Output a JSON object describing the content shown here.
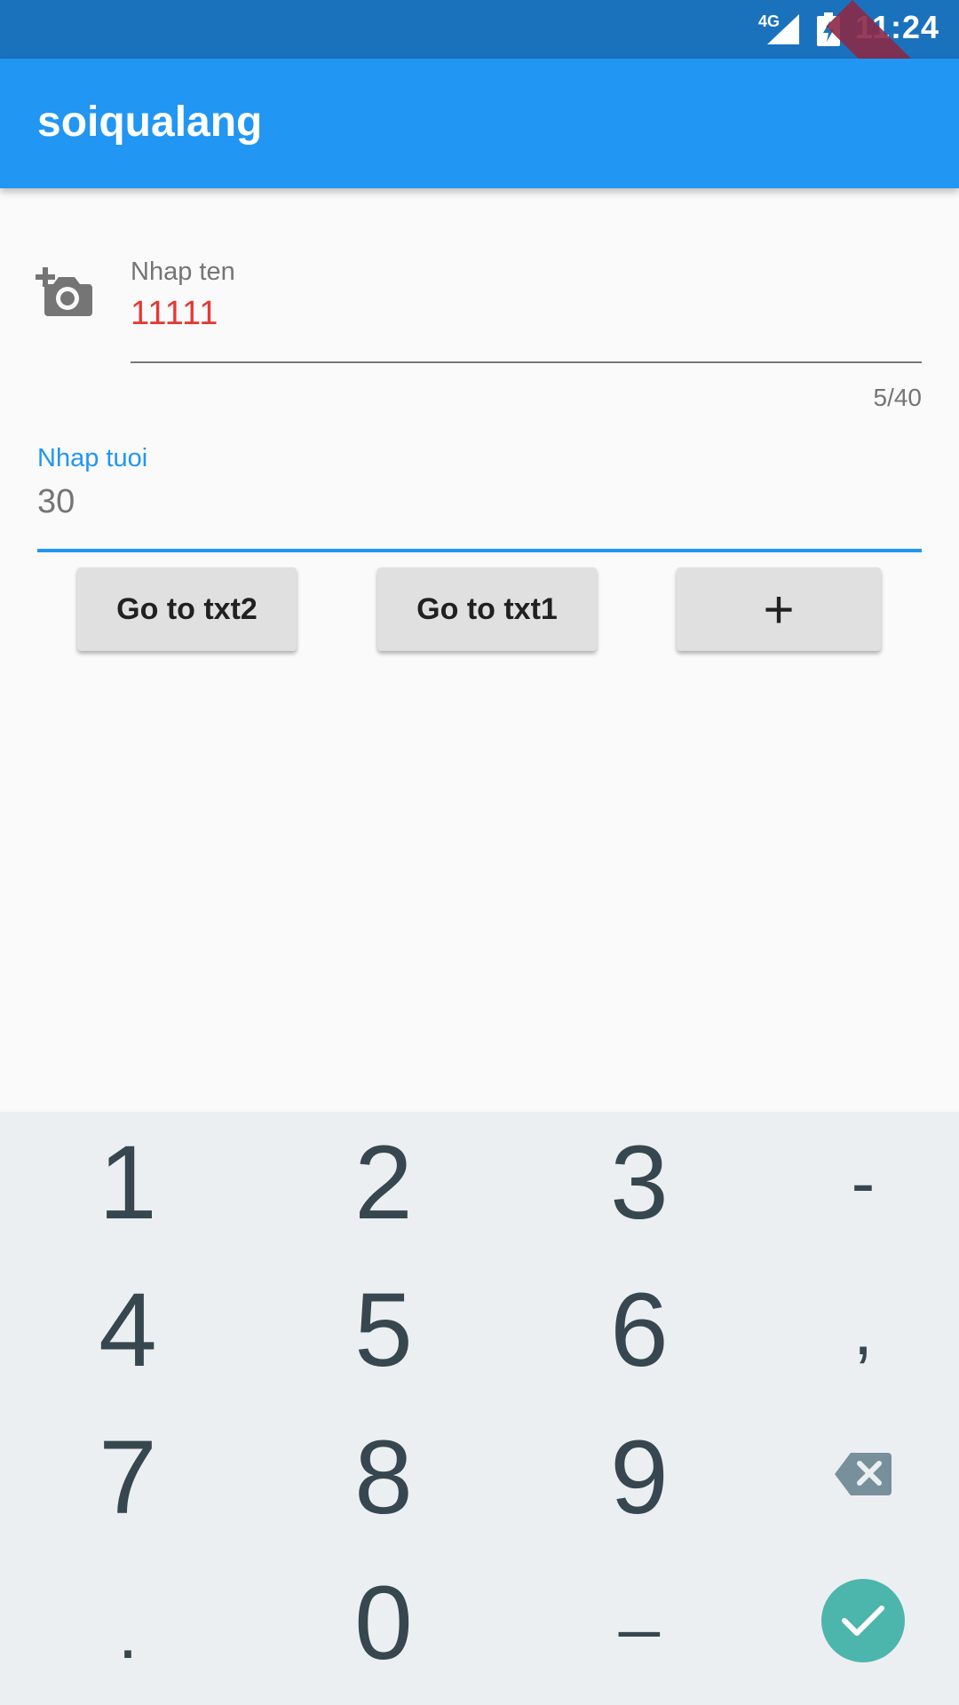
{
  "status_bar": {
    "network": "4G",
    "time": "11:24"
  },
  "debug_banner": "DEBUG",
  "app_bar": {
    "title": "soiqualang"
  },
  "name_field": {
    "label": "Nhap ten",
    "value": "11111",
    "counter": "5/40"
  },
  "age_field": {
    "label": "Nhap tuoi",
    "value": "30"
  },
  "buttons": {
    "go_txt2": "Go to txt2",
    "go_txt1": "Go to txt1",
    "add": "+"
  },
  "keyboard": {
    "keys": [
      "1",
      "2",
      "3",
      "-",
      "4",
      "5",
      "6",
      ",",
      "7",
      "8",
      "9",
      ".",
      "0",
      "_"
    ]
  },
  "colors": {
    "primary": "#2196f3",
    "status_bar": "#1a72bd",
    "error_text": "#e53935",
    "keyboard_bg": "#eceff1",
    "done_key": "#4db6ac"
  }
}
